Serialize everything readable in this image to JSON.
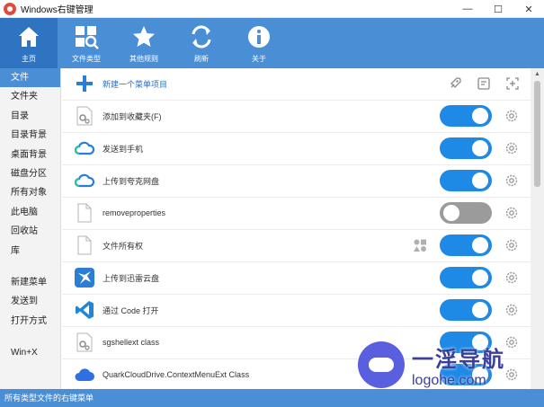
{
  "window": {
    "title": "Windows右键管理",
    "minimize": "—",
    "maximize": "☐",
    "close": "✕"
  },
  "toolbar": {
    "items": [
      {
        "label": "主页",
        "icon": "home-icon",
        "active": true
      },
      {
        "label": "文件类型",
        "icon": "file-types-icon",
        "active": false
      },
      {
        "label": "其他规则",
        "icon": "star-icon",
        "active": false
      },
      {
        "label": "刷新",
        "icon": "refresh-icon",
        "active": false
      },
      {
        "label": "关于",
        "icon": "info-icon",
        "active": false
      }
    ]
  },
  "sidebar": {
    "items": [
      {
        "label": "文件",
        "active": true
      },
      {
        "label": "文件夹"
      },
      {
        "label": "目录"
      },
      {
        "label": "目录背景"
      },
      {
        "label": "桌面背景"
      },
      {
        "label": "磁盘分区"
      },
      {
        "label": "所有对象"
      },
      {
        "label": "此电脑"
      },
      {
        "label": "回收站"
      },
      {
        "label": "库"
      },
      {
        "label": "新建菜单"
      },
      {
        "label": "发送到"
      },
      {
        "label": "打开方式"
      },
      {
        "label": "Win+X"
      }
    ]
  },
  "main": {
    "add_item_label": "新建一个菜单项目",
    "rows": [
      {
        "label": "添加到收藏夹(F)",
        "icon": "gear-file-icon",
        "enabled": true
      },
      {
        "label": "发送到手机",
        "icon": "cloud-icon",
        "enabled": true
      },
      {
        "label": "上传到夸克网盘",
        "icon": "cloud-icon",
        "enabled": true
      },
      {
        "label": "removeproperties",
        "icon": "blank-file-icon",
        "enabled": false
      },
      {
        "label": "文件所有权",
        "icon": "blank-file-icon",
        "enabled": true,
        "extra_icon": "shapes-icon"
      },
      {
        "label": "上传到迅雷云盘",
        "icon": "thunder-bird-icon",
        "enabled": true
      },
      {
        "label": "通过 Code 打开",
        "icon": "vscode-icon",
        "enabled": true
      },
      {
        "label": "sgshellext class",
        "icon": "gear-file-icon",
        "enabled": true
      },
      {
        "label": "QuarkCloudDrive.ContextMenuExt Class",
        "icon": "quark-cloud-icon",
        "enabled": true
      }
    ]
  },
  "statusbar": {
    "text": "所有类型文件的右键菜单"
  },
  "watermark": {
    "brand": "一淫导航",
    "url": "logohe.com"
  },
  "colors": {
    "accent": "#4a8fd6",
    "toggle_on": "#1f8ae6",
    "toggle_off": "#9b9b9b"
  }
}
